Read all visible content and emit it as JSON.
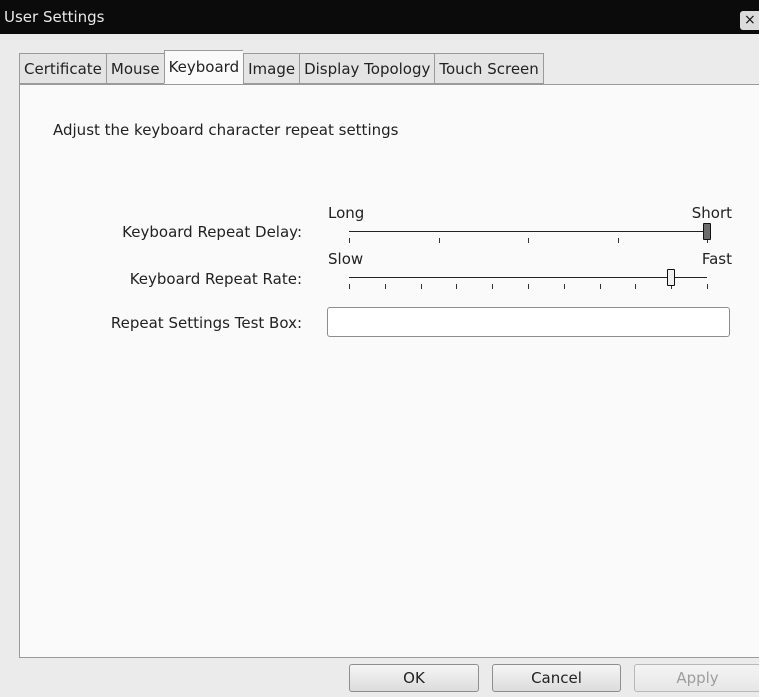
{
  "window": {
    "title": "User Settings",
    "close_glyph": "×"
  },
  "tabs": [
    {
      "label": "Certificate",
      "active": false
    },
    {
      "label": "Mouse",
      "active": false
    },
    {
      "label": "Keyboard",
      "active": true
    },
    {
      "label": "Image",
      "active": false
    },
    {
      "label": "Display Topology",
      "active": false
    },
    {
      "label": "Touch Screen",
      "active": false
    }
  ],
  "keyboard": {
    "description": "Adjust the keyboard character repeat settings",
    "repeat_delay": {
      "label": "Keyboard Repeat Delay:",
      "min_label": "Long",
      "max_label": "Short",
      "ticks": 5,
      "value_fraction": 1.0
    },
    "repeat_rate": {
      "label": "Keyboard Repeat Rate:",
      "min_label": "Slow",
      "max_label": "Fast",
      "ticks": 11,
      "value_fraction": 0.9
    },
    "test_box": {
      "label": "Repeat Settings Test Box:",
      "value": ""
    }
  },
  "buttons": {
    "ok": "OK",
    "cancel": "Cancel",
    "apply": "Apply"
  }
}
